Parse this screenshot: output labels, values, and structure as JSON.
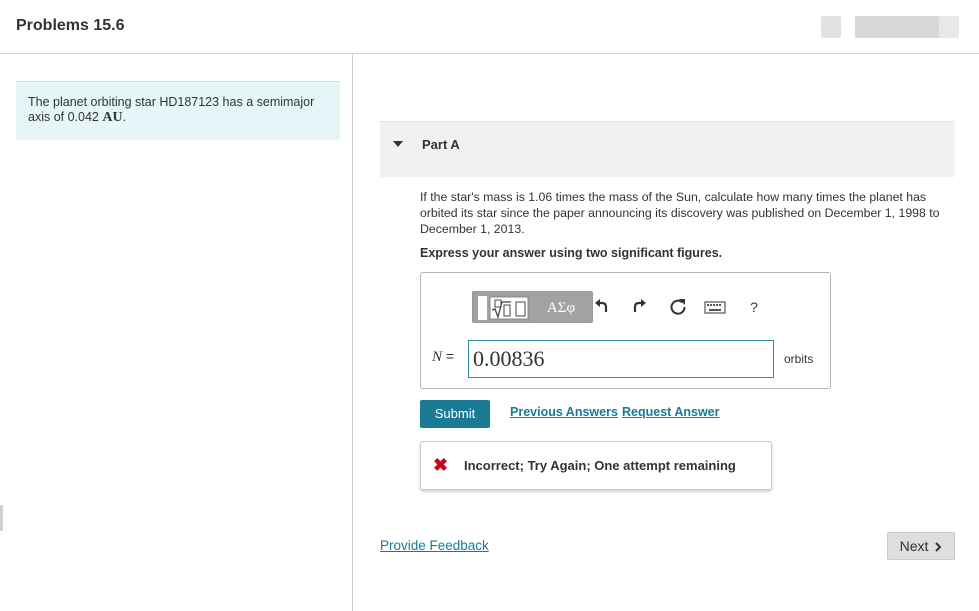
{
  "header": {
    "title": "Problems 15.6"
  },
  "intro": {
    "text": "The planet orbiting star HD187123 has a semimajor axis of 0.042 ",
    "unit": "AU",
    "period": "."
  },
  "part": {
    "label": "Part A",
    "question": "If the star's mass is 1.06 times the mass of the Sun, calculate how many times the planet has orbited its star since the paper announcing its discovery was published on December 1, 1998 to December 1, 2013.",
    "instruction": "Express your answer using two significant figures."
  },
  "toolbar": {
    "greek_label": "ΑΣφ",
    "help_label": "?",
    "icons": [
      "templates-icon",
      "greek-symbols-icon",
      "undo-icon",
      "redo-icon",
      "reset-icon",
      "keyboard-icon",
      "help-icon"
    ]
  },
  "answer": {
    "variable": "N",
    "equals": "=",
    "value": "0.00836",
    "unit": "orbits"
  },
  "actions": {
    "submit_label": "Submit",
    "previous_answers_label": "Previous Answers",
    "request_answer_label": "Request Answer"
  },
  "feedback": {
    "message": "Incorrect; Try Again; One attempt remaining",
    "status_color": "#d0021b"
  },
  "footer": {
    "provide_feedback_label": "Provide Feedback",
    "next_label": "Next"
  },
  "colors": {
    "accent": "#1a7a96",
    "info_bg": "#e5f5f8",
    "part_bar_bg": "#f1f1f1"
  }
}
